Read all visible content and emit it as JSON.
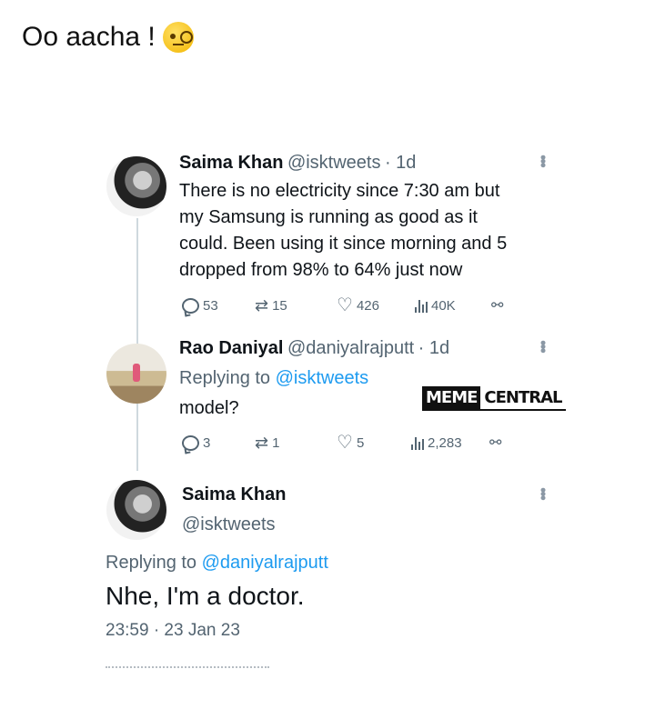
{
  "caption": {
    "text": "Oo aacha !",
    "emoji": "face-with-monocle-emoji"
  },
  "tweet1": {
    "name": "Saima Khan",
    "handle": "@isktweets",
    "time": "· 1d",
    "lines": [
      "There is no electricity since 7:30 am but",
      "my Samsung is running as good as it",
      "could. Been using it since morning and 5",
      "dropped from 98% to 64% just now"
    ],
    "replies": "53",
    "retweets": "15",
    "likes": "426",
    "views": "40K"
  },
  "tweet2": {
    "name": "Rao Daniyal",
    "handle": "@daniyalrajputt",
    "time": "· 1d",
    "replying_prefix": "Replying to ",
    "replying_to": "@isktweets",
    "text": "model?",
    "replies": "3",
    "retweets": "1",
    "likes": "5",
    "views": "2,283"
  },
  "watermark": {
    "part1": "MEME",
    "part2": "CENTRAL"
  },
  "tweet3": {
    "name": "Saima Khan",
    "handle": "@isktweets",
    "replying_prefix": "Replying to ",
    "replying_to": "@daniyalrajputt",
    "text": "Nhe, I'm a doctor.",
    "timestamp": "23:59 · 23 Jan 23"
  },
  "colors": {
    "link": "#1d9bf0",
    "muted": "#536471",
    "text": "#0f1419"
  }
}
